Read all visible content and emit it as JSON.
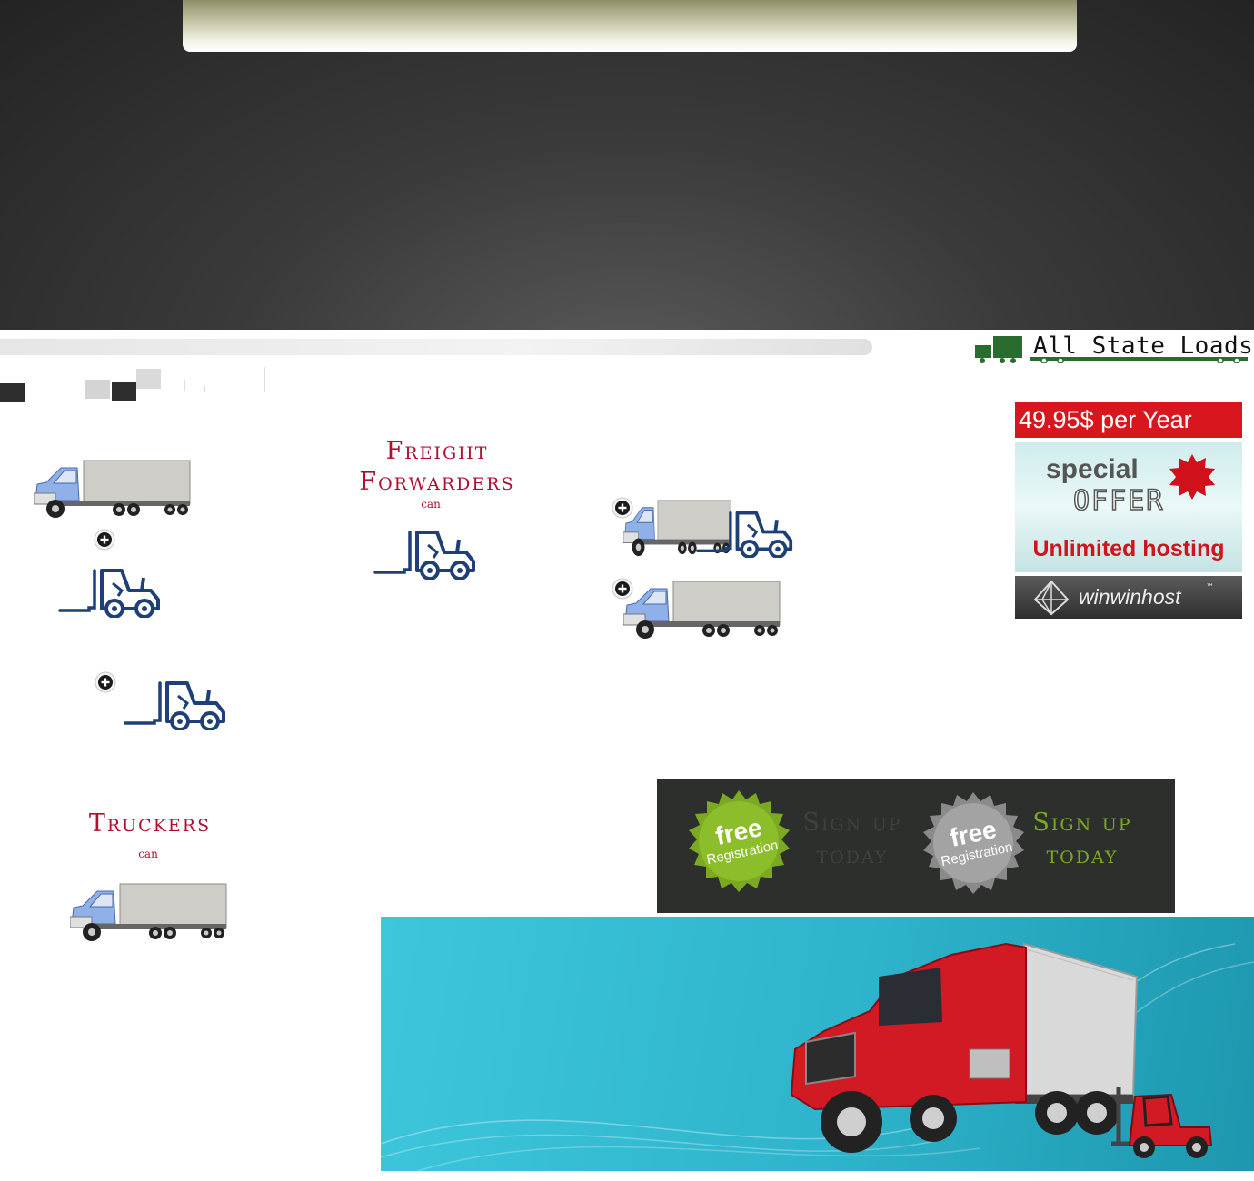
{
  "logo": {
    "title": "All State Loads"
  },
  "sections": {
    "freight_forwarders": {
      "heading_line1": "Freight",
      "heading_line2": "Forwarders",
      "subtext": "can"
    },
    "truckers": {
      "heading": "Truckers",
      "subtext": "can"
    }
  },
  "promo": {
    "price": "49.95$ per Year",
    "special": "special",
    "offer": "OFFER",
    "unlimited": "Unlimited hosting",
    "host_name": "winwinhost",
    "trademark": "™"
  },
  "signup": {
    "badge_word": "free",
    "badge_sub": "Registration",
    "line1": "Sign up",
    "line2": "today"
  },
  "icons": {
    "truck": "truck-icon",
    "forklift": "forklift-icon",
    "plus": "plus-circle-icon"
  },
  "colors": {
    "heading_red": "#b01030",
    "logo_green": "#2a6b2f",
    "promo_red": "#d8161e",
    "signup_green": "#7ba921",
    "truck_blue": "#8fb0e8",
    "forklift_navy": "#1f3f78"
  }
}
